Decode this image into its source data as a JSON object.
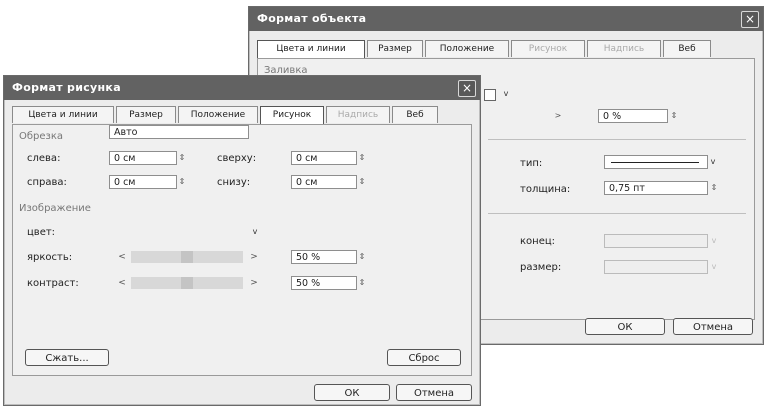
{
  "back_dialog": {
    "title": "Формат объекта",
    "close": "×",
    "tabs": [
      "Цвета и линии",
      "Размер",
      "Положение",
      "Рисунок",
      "Надпись",
      "Веб"
    ],
    "header_fragment": "Заливка",
    "transparency_value": "0 %",
    "line_type_label": "тип:",
    "line_thickness_label": "толщина:",
    "line_thickness_value": "0,75 пт",
    "end_label": "конец:",
    "size_label": "размер:",
    "ok": "ОК",
    "cancel": "Отмена"
  },
  "front_dialog": {
    "title": "Формат рисунка",
    "close": "×",
    "tabs": [
      "Цвета и линии",
      "Размер",
      "Положение",
      "Рисунок",
      "Надпись",
      "Веб"
    ],
    "crop": {
      "group_label": "Обрезка",
      "left_label": "слева:",
      "left_value": "0 см",
      "right_label": "справа:",
      "right_value": "0 см",
      "top_label": "сверху:",
      "top_value": "0 см",
      "bottom_label": "снизу:",
      "bottom_value": "0 см"
    },
    "image": {
      "group_label": "Изображение",
      "color_label": "цвет:",
      "color_value": "Авто",
      "brightness_label": "яркость:",
      "brightness_value": "50 %",
      "contrast_label": "контраст:",
      "contrast_value": "50 %"
    },
    "compress": "Сжать...",
    "reset": "Сброс",
    "ok": "ОК",
    "cancel": "Отмена"
  },
  "icons": {
    "spin": "⇕",
    "left_arrow": "<",
    "right_arrow": ">",
    "dropdown": "v"
  }
}
